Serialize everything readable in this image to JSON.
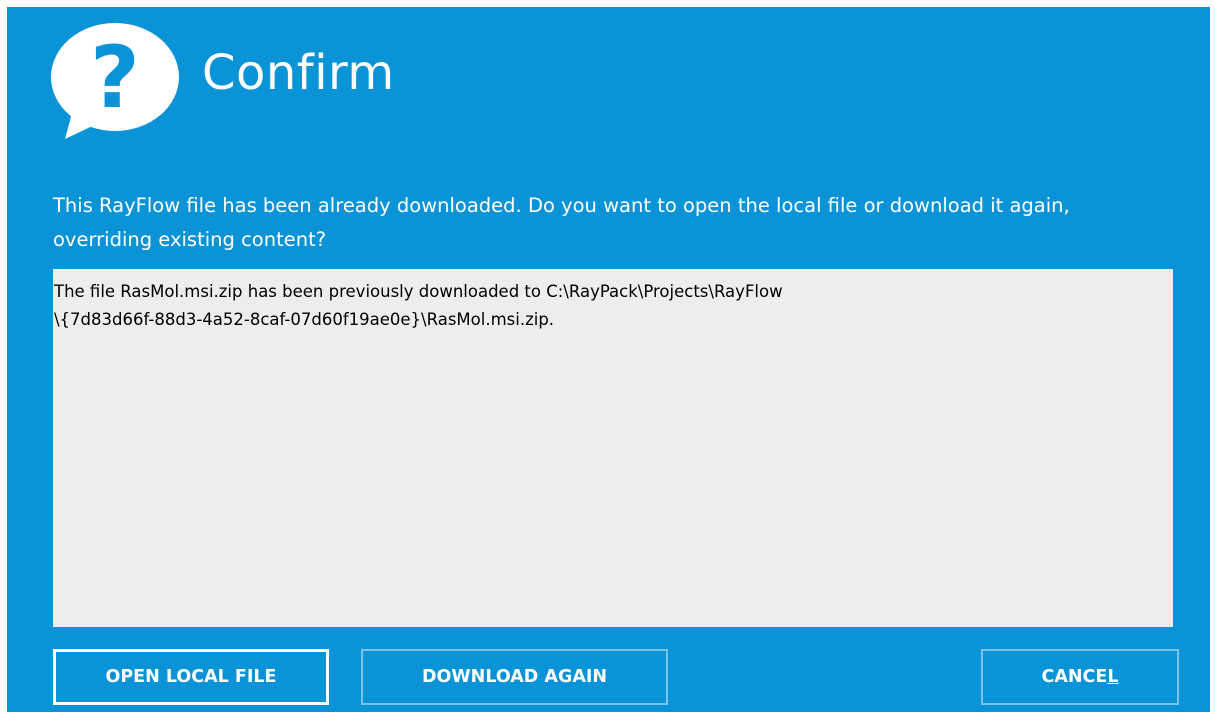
{
  "dialog": {
    "title": "Confirm",
    "icon": "question-bubble-icon",
    "message": "This RayFlow file has been already downloaded. Do you want to open the local file or download it again, overriding existing content?",
    "details": "The file RasMol.msi.zip has been previously downloaded to C:\\RayPack\\Projects\\RayFlow\n\\{7d83d66f-88d3-4a52-8caf-07d60f19ae0e}\\RasMol.msi.zip."
  },
  "buttons": {
    "open_local_label": "OPEN LOCAL FILE",
    "download_again_label": "DOWNLOAD AGAIN",
    "cancel_label_main": "CANCE",
    "cancel_label_mnemonic": "L"
  },
  "colors": {
    "background": "#0a93d6",
    "details_background": "#ededed",
    "text": "#ffffff"
  }
}
